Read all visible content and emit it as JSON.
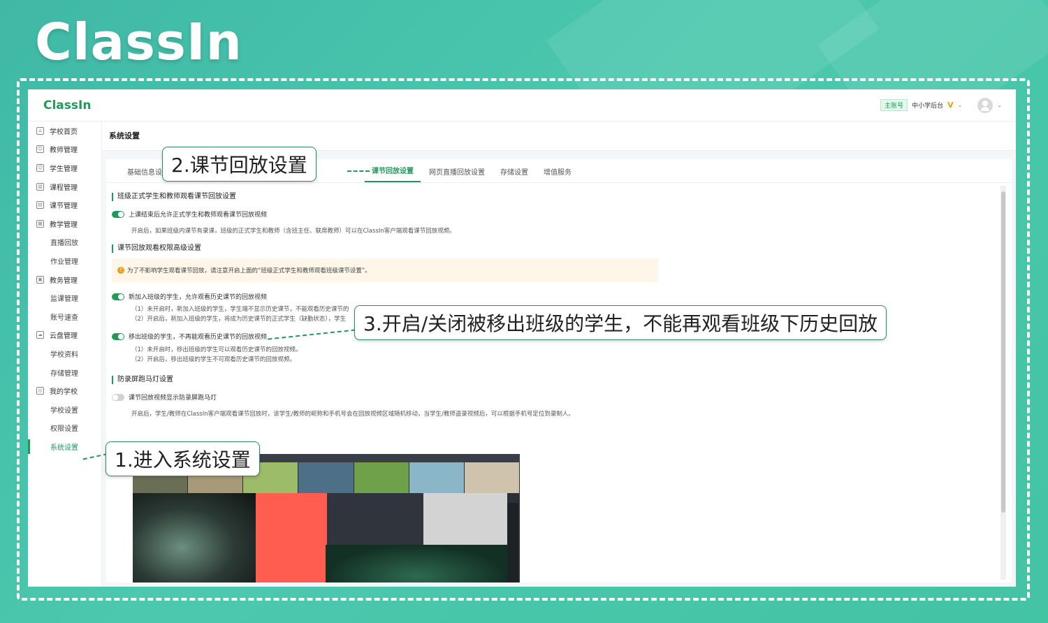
{
  "brand": {
    "title": "ClassIn"
  },
  "app": {
    "logo": "ClassIn",
    "account_badge": "主账号",
    "account_name": "中小学后台",
    "vip": "V",
    "chevron": "⌄"
  },
  "sidebar": {
    "items": [
      {
        "label": "学校首页",
        "icon": "home-icon",
        "glyph": "⌂",
        "sub": false,
        "active": false
      },
      {
        "label": "教师管理",
        "icon": "user-icon",
        "glyph": "☺",
        "sub": false,
        "active": false
      },
      {
        "label": "学生管理",
        "icon": "user-icon",
        "glyph": "☺",
        "sub": false,
        "active": false
      },
      {
        "label": "课程管理",
        "icon": "grid-icon",
        "glyph": "▥",
        "sub": false,
        "active": false
      },
      {
        "label": "课节管理",
        "icon": "lesson-icon",
        "glyph": "▤",
        "sub": false,
        "active": false
      },
      {
        "label": "教学管理",
        "icon": "teach-icon",
        "glyph": "▦",
        "sub": false,
        "active": false
      },
      {
        "label": "直播回放",
        "sub": true,
        "active": false
      },
      {
        "label": "作业管理",
        "sub": true,
        "active": false
      },
      {
        "label": "教务管理",
        "icon": "affairs-icon",
        "glyph": "▣",
        "sub": false,
        "active": false
      },
      {
        "label": "监课管理",
        "sub": true,
        "active": false
      },
      {
        "label": "账号速查",
        "sub": true,
        "active": false
      },
      {
        "label": "云盘管理",
        "icon": "cloud-icon",
        "glyph": "☁",
        "sub": false,
        "active": false
      },
      {
        "label": "学校资料",
        "sub": true,
        "active": false
      },
      {
        "label": "存储管理",
        "sub": true,
        "active": false
      },
      {
        "label": "我的学校",
        "icon": "school-icon",
        "glyph": "◎",
        "sub": false,
        "active": false
      },
      {
        "label": "学校设置",
        "sub": true,
        "active": false
      },
      {
        "label": "权限设置",
        "sub": true,
        "active": false
      },
      {
        "label": "系统设置",
        "sub": true,
        "active": true
      }
    ]
  },
  "main": {
    "page_title": "系统设置",
    "tabs": [
      {
        "label": "基础信息设置",
        "active": false
      },
      {
        "label": "课节回放设置",
        "active": true
      },
      {
        "label": "网页直播回放设置",
        "active": false
      },
      {
        "label": "存储设置",
        "active": false
      },
      {
        "label": "增值服务",
        "active": false
      }
    ],
    "sections": {
      "s1_title": "班级正式学生和教师观看课节回放设置",
      "s1_toggle": "上课结束后允许正式学生和教师观看课节回放视频",
      "s1_desc": "开启后，如果班级内课节有录课，班级的正式学生和教师（含班主任、联席教师）可以在ClassIn客户端观看课节回放视频。",
      "s2_title": "课节回放观看权限高级设置",
      "s2_notice": "为了不影响学生观看课节回放，请注意开启上面的“班级正式学生和教师观看班级课节设置”。",
      "s2_toggle1": "新加入班级的学生，允许观看历史课节的回放视频",
      "s2_t1_d1": "（1）未开启时，新加入班级的学生，学生端不显示历史课节，不能观看历史课节的",
      "s2_t1_d2": "（2）开启后，新加入班级的学生，将成为历史课节的正式学生（缺勤状态），学生",
      "s2_toggle2": "移出班级的学生，不再能观看历史课节的回放视频",
      "s2_t2_d1": "（1）未开启时，移出班级的学生可以观看历史课节的回放视频。",
      "s2_t2_d2": "（2）开启后，移出班级的学生不可观看历史课节的回放视频。",
      "s3_title": "防录屏跑马灯设置",
      "s3_toggle": "课节回放视频显示防录屏跑马灯",
      "s3_desc": "开启后，学生/教师在ClassIn客户端观看课节回放时，该学生/教师的昵称和手机号会在回放视频区域随机移动，当学生/教师盗录视频后，可以根据手机号定位到录制人。"
    }
  },
  "callouts": {
    "step1": "1.进入系统设置",
    "step2": "2.课节回放设置",
    "step3": "3.开启/关闭被移出班级的学生，不能再观看班级下历史回放"
  },
  "colors": {
    "accent": "#1f9a5a",
    "background": "#43c4a3",
    "notice_bg": "#fdf6e9",
    "warn": "#f0a020"
  }
}
